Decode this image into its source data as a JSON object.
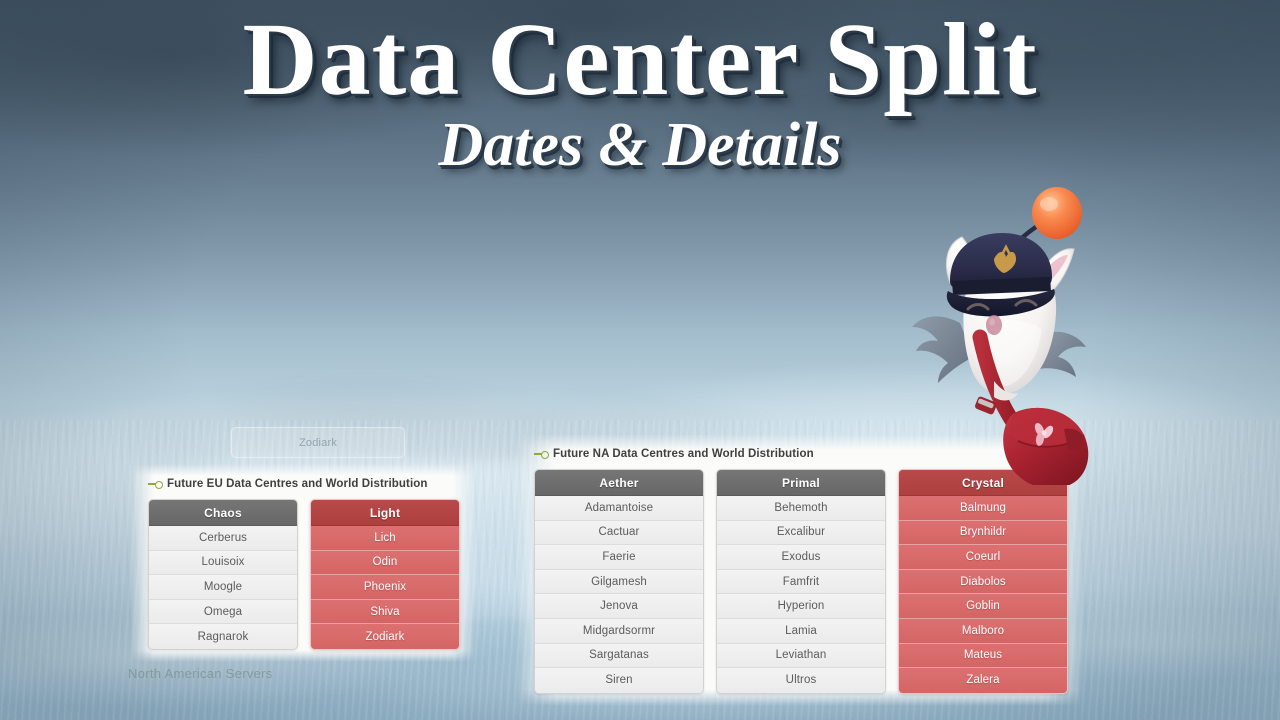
{
  "title": {
    "main": "Data Center Split",
    "sub": "Dates & Details"
  },
  "background": {
    "ghost_row_label": "Zodiark",
    "faded_footer_label": "North American Servers"
  },
  "colors": {
    "header_gray": "#6e6e6e",
    "header_red": "#b34040",
    "cell_gray": "#f0f0f0",
    "cell_red": "#d96a6a",
    "bullet_green": "#93a83a",
    "panel_background": "#fbfbfa",
    "title_text": "#ffffff"
  },
  "panels": [
    {
      "id": "eu",
      "heading": "Future EU Data Centres and World Distribution",
      "bullet_icon": "arrow-circle-icon",
      "tables": [
        {
          "name": "Chaos",
          "style": "gray",
          "worlds": [
            "Cerberus",
            "Louisoix",
            "Moogle",
            "Omega",
            "Ragnarok"
          ]
        },
        {
          "name": "Light",
          "style": "red",
          "worlds": [
            "Lich",
            "Odin",
            "Phoenix",
            "Shiva",
            "Zodiark"
          ]
        }
      ]
    },
    {
      "id": "na",
      "heading": "Future NA Data Centres and World Distribution",
      "bullet_icon": "arrow-circle-icon",
      "tables": [
        {
          "name": "Aether",
          "style": "gray",
          "worlds": [
            "Adamantoise",
            "Cactuar",
            "Faerie",
            "Gilgamesh",
            "Jenova",
            "Midgardsormr",
            "Sargatanas",
            "Siren"
          ]
        },
        {
          "name": "Primal",
          "style": "gray",
          "worlds": [
            "Behemoth",
            "Excalibur",
            "Exodus",
            "Famfrit",
            "Hyperion",
            "Lamia",
            "Leviathan",
            "Ultros"
          ]
        },
        {
          "name": "Crystal",
          "style": "red",
          "worlds": [
            "Balmung",
            "Brynhildr",
            "Coeurl",
            "Diabolos",
            "Goblin",
            "Malboro",
            "Mateus",
            "Zalera"
          ]
        }
      ]
    }
  ],
  "mascot": {
    "name": "moogle-mail-carrier",
    "hat_color": "#2b2d4a",
    "pompom_color": "#f4703c",
    "satchel_color": "#a82230",
    "body_color": "#f7f5f3"
  }
}
